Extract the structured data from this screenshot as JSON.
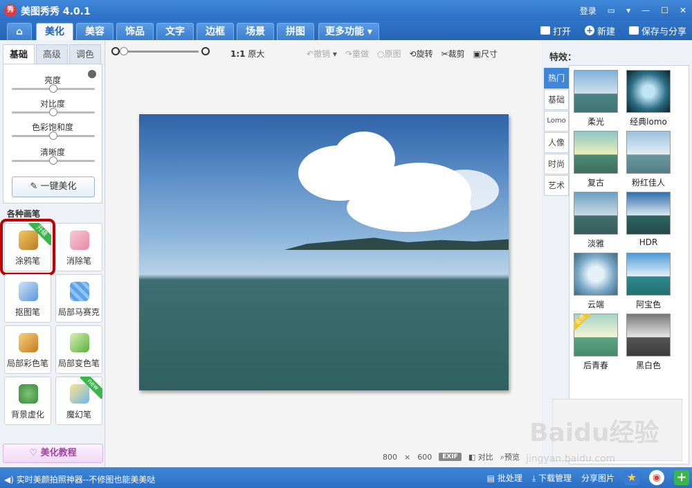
{
  "app": {
    "title": "美图秀秀 4.0.1",
    "logo_text": "秀"
  },
  "titlebar": {
    "login": "登录"
  },
  "tabs": [
    {
      "label": "美化",
      "active": true
    },
    {
      "label": "美容"
    },
    {
      "label": "饰品"
    },
    {
      "label": "文字"
    },
    {
      "label": "边框"
    },
    {
      "label": "场景"
    },
    {
      "label": "拼图"
    },
    {
      "label": "更多功能"
    }
  ],
  "top_actions": {
    "open": "打开",
    "new": "新建",
    "save": "保存与分享"
  },
  "left": {
    "subtabs": [
      "基础",
      "高级",
      "调色"
    ],
    "sliders": [
      {
        "label": "亮度",
        "value": 0.5
      },
      {
        "label": "对比度",
        "value": 0.5
      },
      {
        "label": "色彩饱和度",
        "value": 0.5
      },
      {
        "label": "清晰度",
        "value": 0.5
      }
    ],
    "onekey": "一键美化",
    "section_title": "各种画笔",
    "brushes": [
      {
        "label": "涂鸦笔",
        "ribbon": "升级"
      },
      {
        "label": "消除笔"
      },
      {
        "label": "抠图笔"
      },
      {
        "label": "局部马赛克"
      },
      {
        "label": "局部彩色笔"
      },
      {
        "label": "局部变色笔"
      },
      {
        "label": "背景虚化"
      },
      {
        "label": "魔幻笔",
        "ribbon": "new"
      }
    ],
    "tutorial": "美化教程"
  },
  "toolbar": {
    "ratio": "1:1",
    "orig_size": "原大",
    "undo": "撤销",
    "redo": "重做",
    "original": "原图",
    "rotate": "旋转",
    "crop": "裁剪",
    "resize": "尺寸"
  },
  "image_info": {
    "width": "800",
    "times": "×",
    "height": "600",
    "exif": "EXIF",
    "compare": "对比",
    "preview": "预览"
  },
  "right": {
    "title": "特效：",
    "categories": [
      "热门",
      "基础",
      "Lomo",
      "人像",
      "时尚",
      "艺术"
    ],
    "effects": [
      {
        "label": "柔光"
      },
      {
        "label": "经典lomo"
      },
      {
        "label": "复古"
      },
      {
        "label": "粉红佳人"
      },
      {
        "label": "淡雅"
      },
      {
        "label": "HDR"
      },
      {
        "label": "云端"
      },
      {
        "label": "阿宝色"
      },
      {
        "label": "后青春",
        "badge": "会员"
      },
      {
        "label": "黑白色"
      }
    ]
  },
  "statusbar": {
    "left": "实时美颜拍照神器--不修图也能美美哒",
    "batch": "批处理",
    "download": "下载管理",
    "share": "分享图片"
  },
  "watermark": {
    "main": "Baidu经验",
    "sub": "jingyan.baidu.com"
  }
}
